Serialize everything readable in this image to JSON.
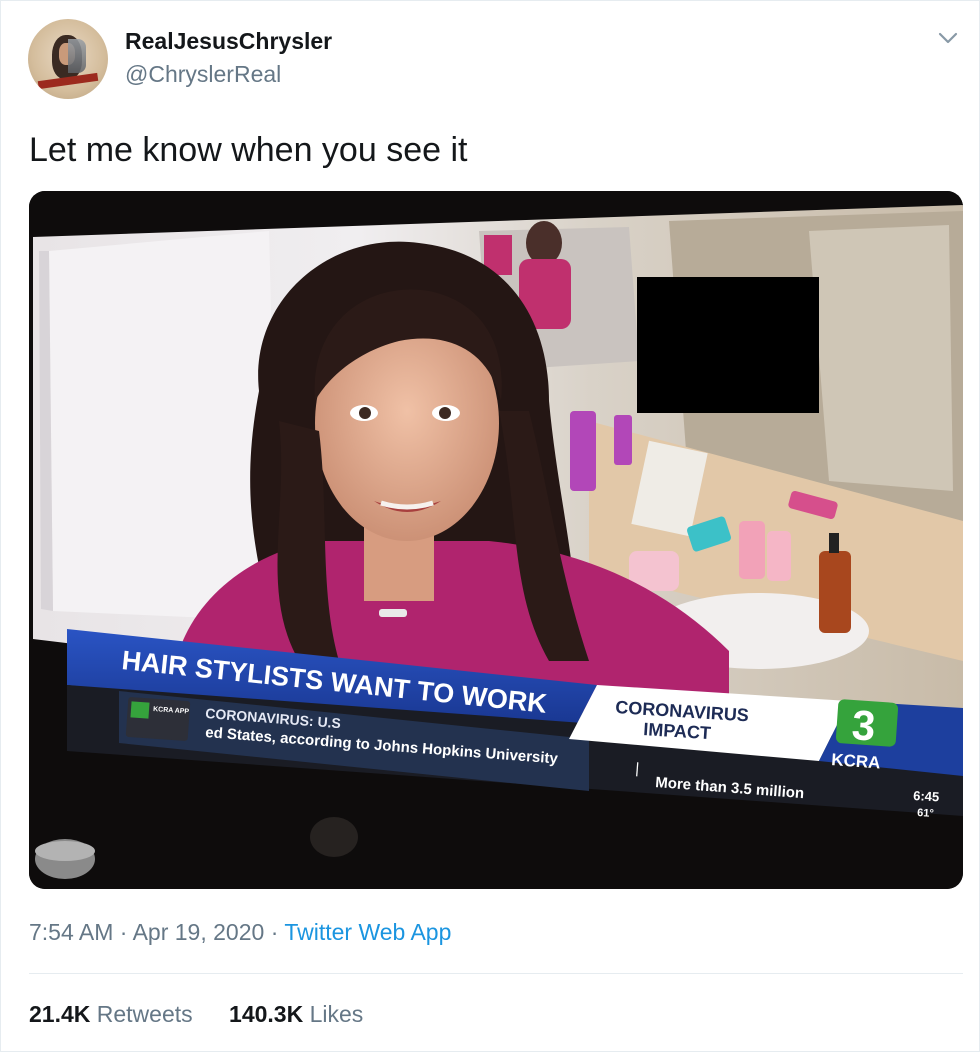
{
  "tweet": {
    "display_name": "RealJesusChrysler",
    "handle": "@ChryslerReal",
    "text": "Let me know when you see it",
    "time": "7:54 AM",
    "date": "Apr 19, 2020",
    "separator": "·",
    "source": "Twitter Web App",
    "retweets_count": "21.4K",
    "retweets_label": "Retweets",
    "likes_count": "140.3K",
    "likes_label": "Likes"
  },
  "icons": {
    "menu": "chevron-down-icon",
    "avatar": "profile-avatar"
  },
  "broadcast": {
    "headline": "HAIR STYLISTS WANT TO WORK",
    "topic_line1": "CORONAVIRUS",
    "topic_line2": "IMPACT",
    "app_badge": "KCRA APP",
    "ticker_topic": "CORONAVIRUS: U.S",
    "ticker_text": "ed States, according to Johns Hopkins University",
    "ticker_text2": "More than 3.5 million",
    "channel_number": "3",
    "station": "KCRA",
    "clock": "6:45",
    "temperature": "61°"
  },
  "colors": {
    "link": "#1b95e0",
    "secondary_text": "#657786",
    "banner_blue": "#1d3f9e",
    "station_green": "#35a33c",
    "shirt_magenta": "#b0246e"
  }
}
